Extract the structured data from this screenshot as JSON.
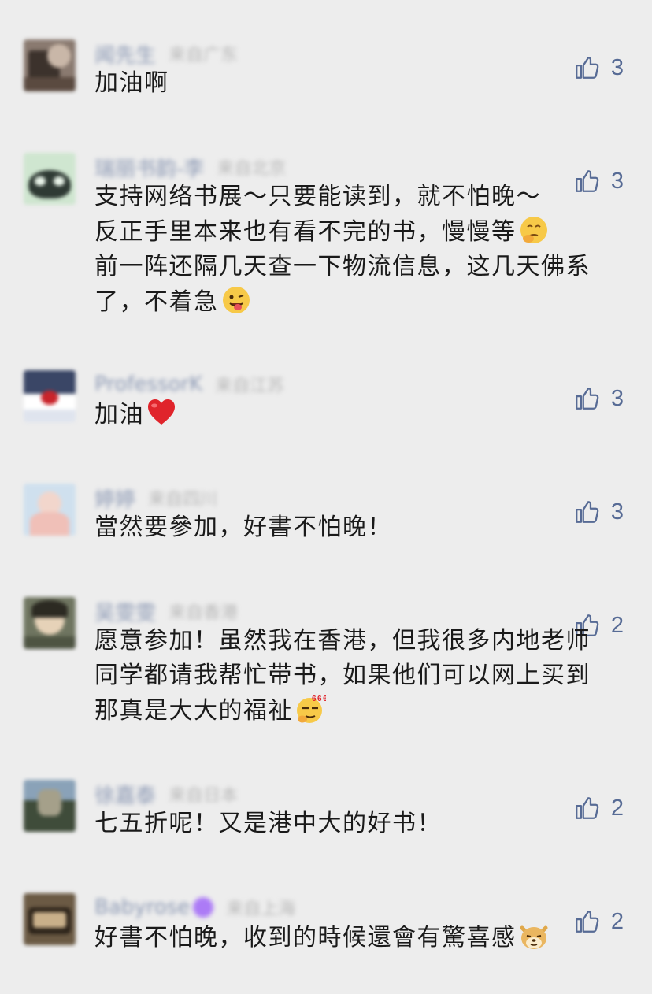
{
  "comments": [
    {
      "name": "闻先生",
      "location": "来自广东",
      "likes": "3",
      "lines": [
        "加油啊"
      ],
      "emoji": null
    },
    {
      "name": "瑞丽书韵-李",
      "location": "来自北京",
      "likes": "3",
      "lines": [
        "支持网络书展～只要能读到，就不怕晚～",
        "反正手里本来也有看不完的书，慢慢等",
        "前一阵还隔几天查一下物流信息，这几天佛系",
        "了，不着急"
      ],
      "emoji": "thinking-face, winking-tongue-face"
    },
    {
      "name": "ProfessorK",
      "location": "来自江苏",
      "likes": "3",
      "lines": [
        "加油"
      ],
      "emoji": "red-heart"
    },
    {
      "name": "婷婷",
      "location": "来自四川",
      "likes": "3",
      "lines": [
        "當然要參加，好書不怕晚！"
      ],
      "emoji": null
    },
    {
      "name": "吴雯雯",
      "location": "来自香港",
      "likes": "2",
      "lines": [
        "愿意参加！虽然我在香港，但我很多内地老师",
        "同学都请我帮忙带书，如果他们可以网上买到",
        "那真是大大的福祉"
      ],
      "emoji": "666-face"
    },
    {
      "name": "徐嘉泰",
      "location": "来自日本",
      "likes": "2",
      "lines": [
        "七五折呢！又是港中大的好书！"
      ],
      "emoji": null
    },
    {
      "name": "Babyrose",
      "location": "来自上海",
      "likes": "2",
      "lines": [
        "好書不怕晚，收到的時候還會有驚喜感"
      ],
      "emoji": "doge-face"
    }
  ],
  "icons": {
    "like": "thumbs-up-icon"
  },
  "colors": {
    "background": "#ededed",
    "name": "#576b95",
    "text": "#1a1a1a",
    "meta": "#9a9a9a"
  }
}
